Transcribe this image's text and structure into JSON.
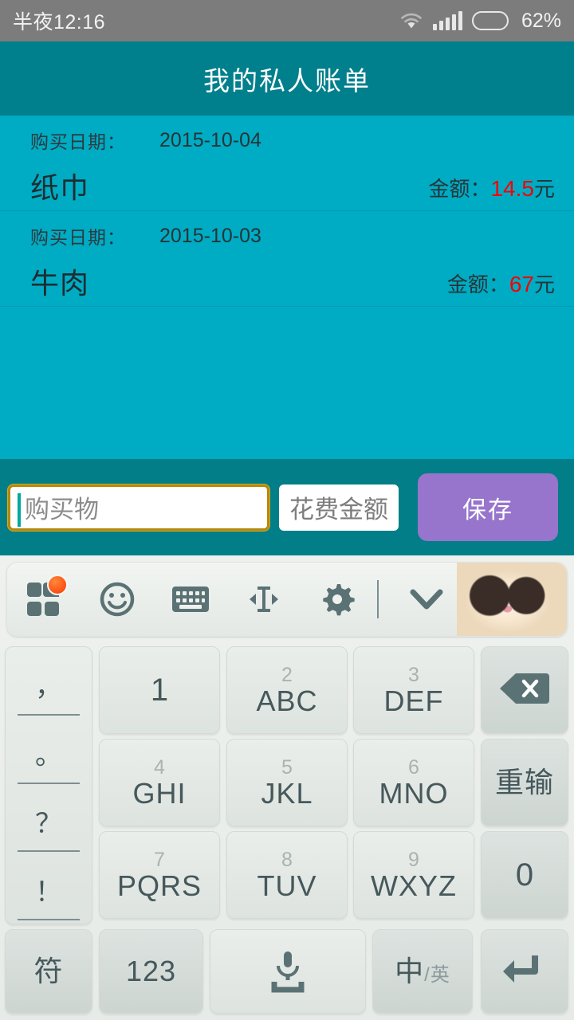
{
  "statusbar": {
    "clock": "半夜12:16",
    "battery_text": "62%",
    "wifi_icon": "wifi-icon",
    "signal_icon": "signal-icon",
    "battery_icon": "battery-icon",
    "battery_level_pct": 62,
    "bg_color": "#7c7c7c"
  },
  "header": {
    "title": "我的私人账单",
    "bg_color": "#007f8c"
  },
  "bills": {
    "date_label": "购买日期：",
    "amount_label": "金额：",
    "currency_unit": "元",
    "amount_color": "#f50000",
    "bg_color": "#00abc4",
    "items": [
      {
        "date": "2015-10-04",
        "name": "纸巾",
        "amount": "14.5"
      },
      {
        "date": "2015-10-03",
        "name": "牛肉",
        "amount": "67"
      }
    ]
  },
  "input_bar": {
    "bg_color": "#017e88",
    "item_field": {
      "placeholder": "购买物",
      "value": "",
      "focused": true,
      "border_color": "#b5890c"
    },
    "amount_field": {
      "placeholder": "花费金额",
      "value": ""
    },
    "save_button": {
      "label": "保存",
      "color": "#9775cd"
    }
  },
  "ime": {
    "toolbar": {
      "icons": [
        {
          "name": "apps-grid-icon",
          "badge": true
        },
        {
          "name": "emoji-smiley-icon",
          "badge": false
        },
        {
          "name": "keyboard-icon",
          "badge": false
        },
        {
          "name": "cursor-move-icon",
          "badge": false
        },
        {
          "name": "gear-icon",
          "badge": false
        },
        {
          "name": "chevron-down-icon",
          "badge": false
        }
      ],
      "badge_color": "#ff5a1a",
      "theme_image": "cat-photo"
    },
    "punctuation_key": {
      "name": "punctuation-key",
      "marks": [
        "，",
        "。",
        "？",
        "！"
      ]
    },
    "rows": [
      [
        {
          "name": "key-1",
          "digit": "",
          "letters": "",
          "single": "1",
          "fn": false
        },
        {
          "name": "key-2",
          "digit": "2",
          "letters": "ABC",
          "single": "",
          "fn": false
        },
        {
          "name": "key-3",
          "digit": "3",
          "letters": "DEF",
          "single": "",
          "fn": false
        },
        {
          "name": "key-backspace",
          "digit": "",
          "letters": "",
          "single": "",
          "icon": "backspace-icon",
          "fn": true
        }
      ],
      [
        {
          "name": "key-4",
          "digit": "4",
          "letters": "GHI",
          "single": "",
          "fn": false
        },
        {
          "name": "key-5",
          "digit": "5",
          "letters": "JKL",
          "single": "",
          "fn": false
        },
        {
          "name": "key-6",
          "digit": "6",
          "letters": "MNO",
          "single": "",
          "fn": false
        },
        {
          "name": "key-redo",
          "digit": "",
          "letters": "",
          "single": "",
          "cn": "重输",
          "fn": true
        }
      ],
      [
        {
          "name": "key-7",
          "digit": "7",
          "letters": "PQRS",
          "single": "",
          "fn": false
        },
        {
          "name": "key-8",
          "digit": "8",
          "letters": "TUV",
          "single": "",
          "fn": false
        },
        {
          "name": "key-9",
          "digit": "9",
          "letters": "WXYZ",
          "single": "",
          "fn": false
        },
        {
          "name": "key-0",
          "digit": "",
          "letters": "",
          "single": "0",
          "fn": true
        }
      ],
      [
        {
          "name": "key-symbols",
          "cn": "符",
          "fn": true
        },
        {
          "name": "key-numeric-mode",
          "cn": "123",
          "fn": true
        },
        {
          "name": "key-space-voice",
          "icon": "microphone-space-icon",
          "fn": false
        },
        {
          "name": "key-language-toggle",
          "cn": "中",
          "cn_small": "/英",
          "fn": true
        },
        {
          "name": "key-enter",
          "icon": "enter-return-icon",
          "fn": true
        }
      ]
    ]
  }
}
